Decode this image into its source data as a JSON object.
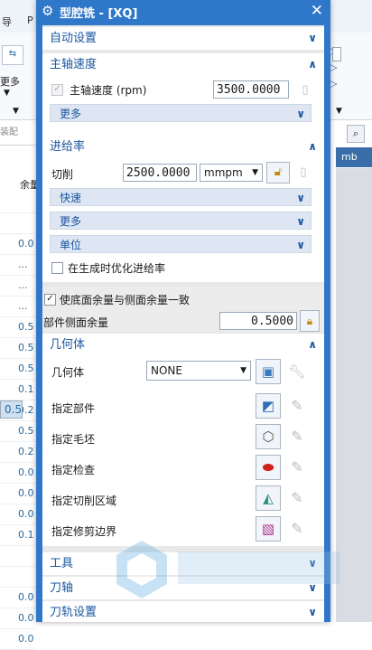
{
  "window": {
    "title": "型腔铣 - [XQ]"
  },
  "background": {
    "menu_items": [
      "导",
      "P"
    ],
    "left_label_more": "更多",
    "left_label_assembly": "装配",
    "column_header": "余量",
    "right_tab": "mb",
    "row_values": [
      "",
      "",
      "0.0",
      "...",
      "...",
      "...",
      "0.5",
      "0.5",
      "0.5",
      "0.1",
      "0.5",
      "0.2",
      "0.5",
      "0.2",
      "0.0",
      "0.0",
      "0.0",
      "0.1",
      "",
      "",
      "0.0",
      "0.0",
      "0.0"
    ]
  },
  "sections": {
    "auto_settings": {
      "title": "自动设置",
      "expanded": false
    },
    "spindle": {
      "title": "主轴速度",
      "expanded": true,
      "checkbox_label": "主轴速度 (rpm)",
      "checked": true,
      "value": "3500.0000",
      "more_label": "更多"
    },
    "feed": {
      "title": "进给率",
      "expanded": true,
      "cut_label": "切削",
      "cut_value": "2500.0000",
      "unit": "mmpm",
      "rapid_label": "快速",
      "more_label": "更多",
      "units_label": "单位",
      "optimize_label": "在生成时优化进给率",
      "optimize_checked": false
    },
    "stock": {
      "consistent_label": "使底面余量与侧面余量一致",
      "consistent_checked": true,
      "side_stock_label": "部件侧面余量",
      "side_stock_value": "0.5000"
    },
    "geometry": {
      "title": "几何体",
      "expanded": true,
      "geometry_label": "几何体",
      "geometry_value": "NONE",
      "items": [
        {
          "label": "指定部件",
          "icon": "part-icon"
        },
        {
          "label": "指定毛坯",
          "icon": "blank-icon"
        },
        {
          "label": "指定检查",
          "icon": "check-icon"
        },
        {
          "label": "指定切削区域",
          "icon": "cut-area-icon"
        },
        {
          "label": "指定修剪边界",
          "icon": "trim-boundary-icon"
        }
      ]
    },
    "tool": {
      "title": "工具",
      "expanded": false
    },
    "axis": {
      "title": "刀轴",
      "expanded": false
    },
    "path": {
      "title": "刀轨设置",
      "expanded": false
    }
  },
  "colors": {
    "title_bar": "#2f77c8",
    "section_header_text": "#1b56a0",
    "sub_row_bg": "#dde6f2"
  }
}
